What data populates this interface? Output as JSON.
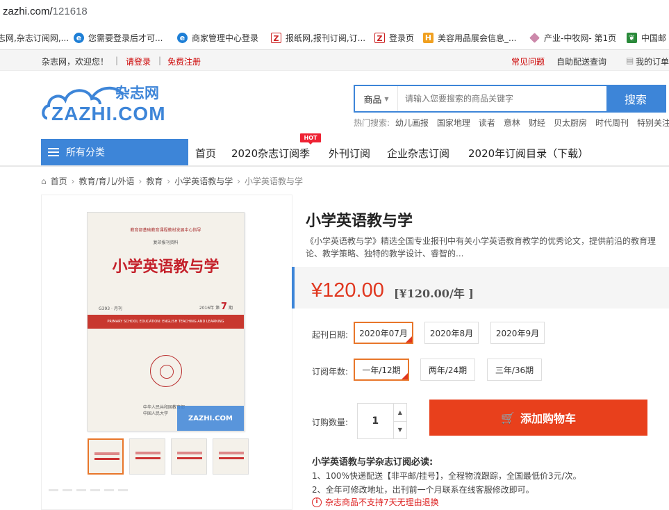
{
  "browser": {
    "url_host": "zazhi.com/",
    "url_path": "121618",
    "bookmarks": [
      {
        "label": "志网,杂志订阅网,...",
        "icon": "site-icon"
      },
      {
        "label": "您需要登录后才可...",
        "icon": "blue-circle-icon"
      },
      {
        "label": "商家管理中心登录",
        "icon": "blue-circle-icon"
      },
      {
        "label": "报纸网,报刊订阅,订...",
        "icon": "z-logo-icon"
      },
      {
        "label": "登录页",
        "icon": "z-logo-icon"
      },
      {
        "label": "美容用品展会信息_...",
        "icon": "h-logo-icon"
      },
      {
        "label": "产业-中牧网- 第1页",
        "icon": "diamond-icon"
      },
      {
        "label": "中国邮",
        "icon": "leaf-icon"
      }
    ]
  },
  "topnav": {
    "welcome": "杂志网，欢迎您！",
    "login": "请登录",
    "register": "免费注册",
    "faq": "常见问题",
    "auto_query": "自助配送查询",
    "my_orders": "我的订单"
  },
  "header": {
    "logo_cn": "杂志网",
    "logo_en": "ZAZHI.COM",
    "search_category": "商品",
    "search_placeholder": "请输入您要搜索的商品关键字",
    "search_button": "搜索",
    "hot_label": "热门搜索:",
    "hot_words": [
      "幼儿画报",
      "国家地理",
      "读者",
      "意林",
      "财经",
      "贝太厨房",
      "时代周刊",
      "特别关注"
    ]
  },
  "mainnav": {
    "all_categories": "所有分类",
    "hot_badge": "HOT",
    "items": [
      "首页",
      "2020杂志订阅季",
      "外刊订阅",
      "企业杂志订阅",
      "2020年订阅目录（下载）"
    ]
  },
  "breadcrumb": [
    "首页",
    "教育/育儿/外语",
    "教育",
    "小学英语教与学",
    "小学英语教与学"
  ],
  "cover": {
    "line1": "教育部基础教育课程教材发展中心指导",
    "line2": "复印报刊资料",
    "title": "小学英语教与学",
    "code": "G393 · 月刊",
    "issue_prefix": "2016年 第",
    "issue_num": "7",
    "issue_suffix": "期",
    "band": "PRIMARY SCHOOL EDUCATION: ENGLISH TEACHING AND LEARNING",
    "publisher_1": "中华人民共和国教育部",
    "publisher_2": "中国人民大学",
    "watermark": "ZAZHI.COM"
  },
  "product": {
    "title": "小学英语教与学",
    "description": "《小学英语教与学》精选全国专业报刊中有关小学英语教育教学的优秀论文，提供前沿的教育理论、教学策略、独特的教学设计、睿智的...",
    "price": "¥120.00",
    "price_per_year": "[¥120.00/年 ]",
    "start_label": "起刊日期:",
    "start_options": [
      "2020年07月",
      "2020年8月",
      "2020年9月"
    ],
    "years_label": "订阅年数:",
    "year_options": [
      "一年/12期",
      "两年/24期",
      "三年/36期"
    ],
    "qty_label": "订购数量:",
    "qty_value": "1",
    "add_to_cart": "添加购物车",
    "notes_title": "小学英语教与学杂志订阅必读:",
    "notes": [
      "1、100%快递配送【非平邮/挂号】，全程物流跟踪，全国最低价3元/次。",
      "2、全年可修改地址，出刊前一个月联系在线客服修改即可。"
    ],
    "warning": "杂志商品不支持7天无理由退换"
  },
  "colors": {
    "accent": "#3d85d8",
    "price": "#e0371f",
    "cart": "#e8401c",
    "selected": "#e8762a"
  }
}
